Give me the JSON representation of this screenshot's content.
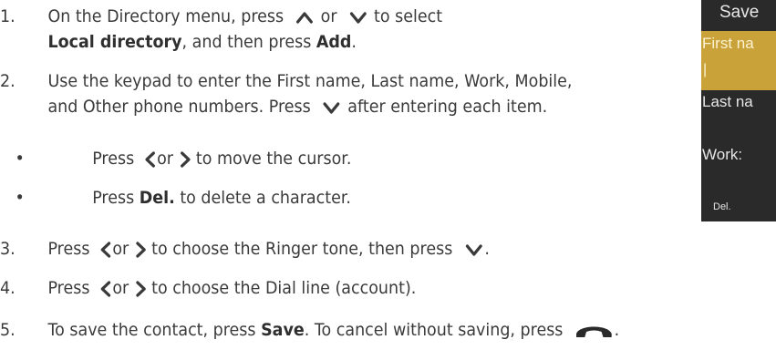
{
  "steps": [
    {
      "number": "1.",
      "lines": [
        {
          "before": "On the Directory menu, press",
          "middle": "or",
          "after": "to select"
        },
        {
          "bold1": "Local directory",
          "text1": ", and then press ",
          "bold2": "Add",
          "text2": "."
        }
      ]
    },
    {
      "number": "2.",
      "lines": [
        {
          "text": "Use the keypad to enter the First name, Last name, Work, Mobile,"
        },
        {
          "before": "and Other phone numbers. Press",
          "after": "after entering each item."
        }
      ]
    },
    {
      "number": "3.",
      "before": "Press",
      "middle": "or",
      "after": "to choose the Ringer tone, then press",
      "end": "."
    },
    {
      "number": "4.",
      "before": "Press",
      "middle": "or",
      "after": "to choose the Dial line (account)."
    },
    {
      "number": "5.",
      "before": "To save the contact, press ",
      "bold": "Save",
      "after": ". To cancel without saving, press",
      "end": "."
    }
  ],
  "bullets": [
    {
      "symbol": "•",
      "before": "Press",
      "middle": "or",
      "after": "to move the cursor."
    },
    {
      "symbol": "•",
      "before": "Press ",
      "bold": "Del.",
      "after": " to delete a character."
    }
  ],
  "phone": {
    "title": "Save",
    "first_name_label": "First na",
    "cursor": "|",
    "last_name_label": "Last na",
    "work_label": "Work:",
    "softkey_left": "Del."
  },
  "icons": {
    "up": "chevron-up-icon",
    "down": "chevron-down-icon",
    "left": "chevron-left-icon",
    "right": "chevron-right-icon",
    "hangup": "end-call-icon"
  },
  "colors": {
    "text": "#3a3a3a",
    "phone_background": "#2a2a2a",
    "phone_highlight": "#c9a33a"
  }
}
